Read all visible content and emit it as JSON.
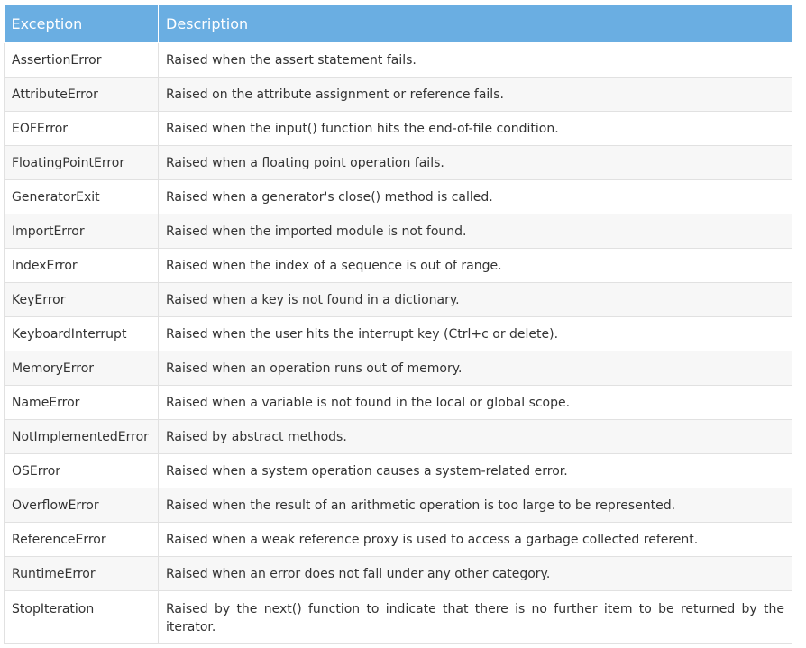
{
  "table": {
    "headers": [
      "Exception",
      "Description"
    ],
    "rows": [
      {
        "exception": "AssertionError",
        "description": "Raised when the assert statement fails."
      },
      {
        "exception": "AttributeError",
        "description": "Raised on the attribute assignment or reference fails."
      },
      {
        "exception": "EOFError",
        "description": "Raised when the input() function hits the end-of-file condition."
      },
      {
        "exception": "FloatingPointError",
        "description": "Raised when a floating point operation fails."
      },
      {
        "exception": "GeneratorExit",
        "description": "Raised when a generator's close() method is called."
      },
      {
        "exception": "ImportError",
        "description": "Raised when the imported module is not found."
      },
      {
        "exception": "IndexError",
        "description": "Raised when the index of a sequence is out of range."
      },
      {
        "exception": "KeyError",
        "description": "Raised when a key is not found in a dictionary."
      },
      {
        "exception": "KeyboardInterrupt",
        "description": "Raised when the user hits the interrupt key (Ctrl+c or delete)."
      },
      {
        "exception": "MemoryError",
        "description": "Raised when an operation runs out of memory."
      },
      {
        "exception": "NameError",
        "description": "Raised when a variable is not found in the local or global scope."
      },
      {
        "exception": "NotImplementedError",
        "description": "Raised by abstract methods."
      },
      {
        "exception": "OSError",
        "description": "Raised when a system operation causes a system-related error."
      },
      {
        "exception": "OverflowError",
        "description": "Raised when the result of an arithmetic operation is too large to be represented."
      },
      {
        "exception": "ReferenceError",
        "description": "Raised when a weak reference proxy is used to access a garbage collected referent."
      },
      {
        "exception": "RuntimeError",
        "description": "Raised when an error does not fall under any other category."
      },
      {
        "exception": "StopIteration",
        "description": "Raised by the next() function to indicate that there is no further item to be returned by the iterator."
      }
    ],
    "colors": {
      "header_bg": "#6aaee2",
      "header_text": "#ffffff",
      "row_alt_bg": "#f7f7f7",
      "border": "#e1e1e1"
    }
  }
}
